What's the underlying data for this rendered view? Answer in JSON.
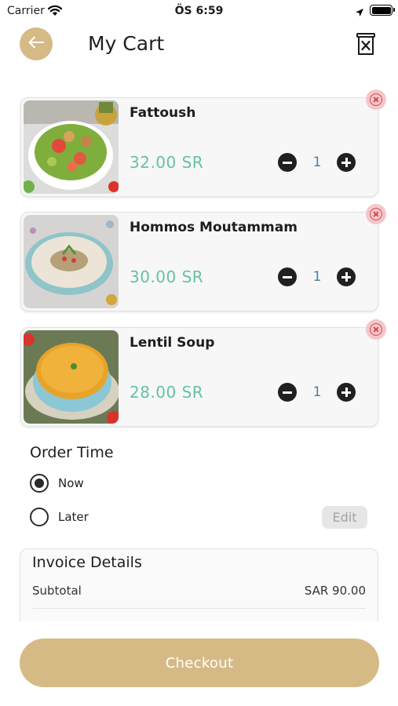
{
  "status_bar": {
    "carrier": "Carrier",
    "time": "ÖS 6:59"
  },
  "header": {
    "title": "My Cart",
    "back_icon": "arrow-left-icon",
    "clear_icon": "trash-x-icon"
  },
  "colors": {
    "accent": "#d6ba86",
    "price": "#66c29e",
    "remove": "#d8454f"
  },
  "cart_items": [
    {
      "name": "Fattoush",
      "price": "32.00 SR",
      "quantity": "1",
      "image": "fattoush-salad"
    },
    {
      "name": "Hommos Moutammam",
      "price": "30.00 SR",
      "quantity": "1",
      "image": "hummus-bowl"
    },
    {
      "name": "Lentil Soup",
      "price": "28.00 SR",
      "quantity": "1",
      "image": "lentil-soup-bowl"
    }
  ],
  "order_time": {
    "title": "Order Time",
    "options": [
      {
        "label": "Now",
        "selected": true
      },
      {
        "label": "Later",
        "selected": false
      }
    ],
    "edit_label": "Edit"
  },
  "invoice": {
    "title": "Invoice Details",
    "subtotal_label": "Subtotal",
    "subtotal_value": "SAR 90.00"
  },
  "checkout_label": "Checkout"
}
